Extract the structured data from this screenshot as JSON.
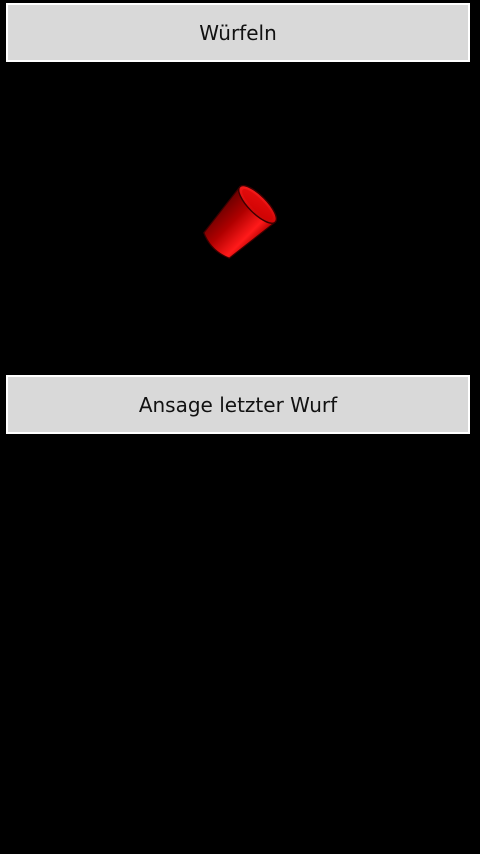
{
  "buttons": {
    "roll_label": "Würfeln",
    "announce_label": "Ansage letzter Wurf"
  },
  "cup": {
    "icon": "dice-cup-icon",
    "color": "#cc0000"
  },
  "colors": {
    "background": "#000000",
    "button_bg": "#d9d9d9",
    "button_border": "#ffffff"
  }
}
